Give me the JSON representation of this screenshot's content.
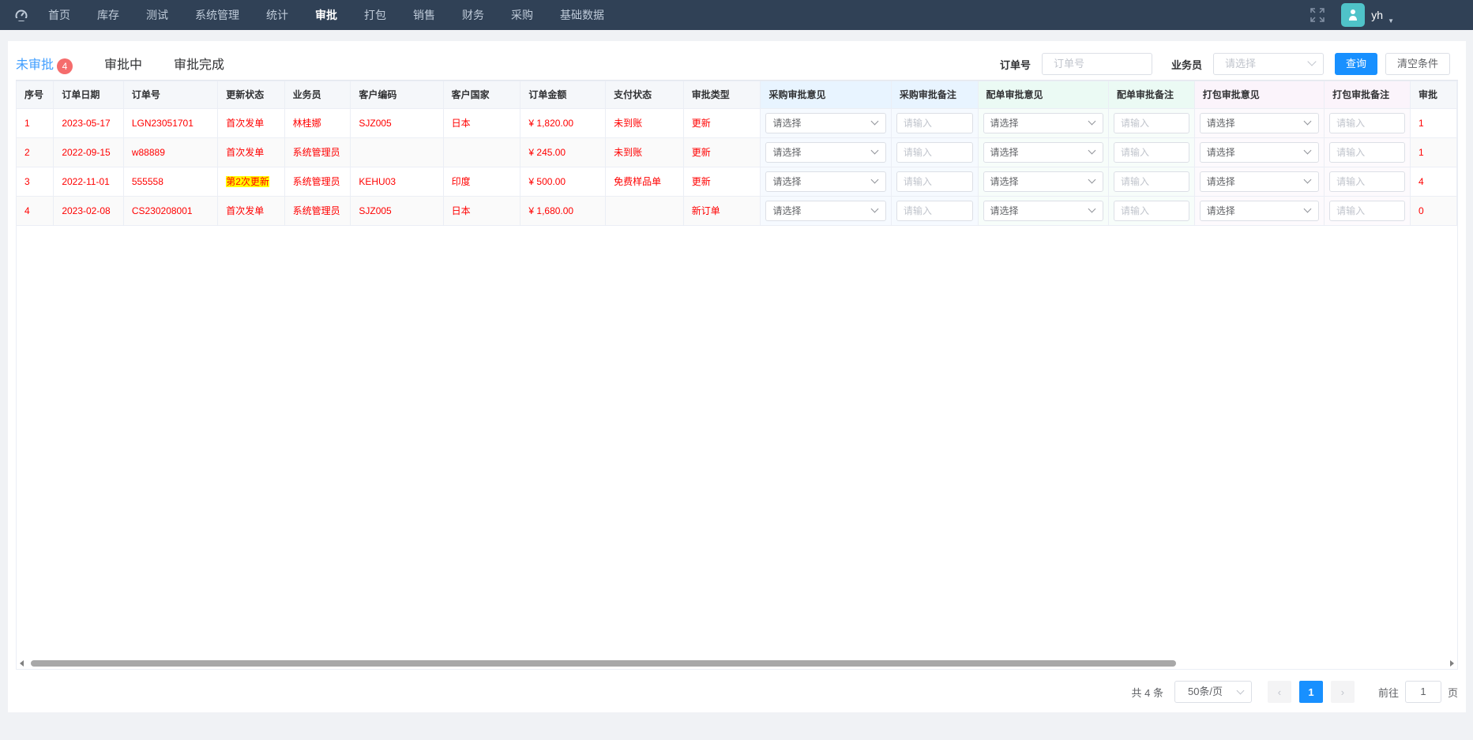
{
  "nav": {
    "items": [
      "首页",
      "库存",
      "测试",
      "系统管理",
      "统计",
      "审批",
      "打包",
      "销售",
      "财务",
      "采购",
      "基础数据"
    ],
    "active_index": 5,
    "username": "yh"
  },
  "tabs": [
    {
      "label": "未审批",
      "badge": "4",
      "active": true
    },
    {
      "label": "审批中",
      "badge": null,
      "active": false
    },
    {
      "label": "审批完成",
      "badge": null,
      "active": false
    }
  ],
  "filters": {
    "order_label": "订单号",
    "order_placeholder": "订单号",
    "salesman_label": "业务员",
    "salesman_placeholder": "请选择",
    "query_button": "查询",
    "clear_button": "清空条件"
  },
  "table": {
    "headers": [
      "序号",
      "订单日期",
      "订单号",
      "更新状态",
      "业务员",
      "客户编码",
      "客户国家",
      "订单金额",
      "支付状态",
      "审批类型",
      "采购审批意见",
      "采购审批备注",
      "配单审批意见",
      "配单审批备注",
      "打包审批意见",
      "打包审批备注",
      "审批"
    ],
    "select_placeholder": "请选择",
    "input_placeholder": "请输入",
    "rows": [
      {
        "idx": "1",
        "date": "2023-05-17",
        "order_no": "LGN23051701",
        "update_status": "首次发单",
        "highlight": false,
        "salesman": "林桂娜",
        "customer_code": "SJZ005",
        "country": "日本",
        "amount": "¥ 1,820.00",
        "pay_status": "未到账",
        "approve_type": "更新",
        "last": "1"
      },
      {
        "idx": "2",
        "date": "2022-09-15",
        "order_no": "w88889",
        "update_status": "首次发单",
        "highlight": false,
        "salesman": "系统管理员",
        "customer_code": "",
        "country": "",
        "amount": "¥ 245.00",
        "pay_status": "未到账",
        "approve_type": "更新",
        "last": "1"
      },
      {
        "idx": "3",
        "date": "2022-11-01",
        "order_no": "555558",
        "update_status": "第2次更新",
        "highlight": true,
        "salesman": "系统管理员",
        "customer_code": "KEHU03",
        "country": "印度",
        "amount": "¥ 500.00",
        "pay_status": "免费样品单",
        "approve_type": "更新",
        "last": "4"
      },
      {
        "idx": "4",
        "date": "2023-02-08",
        "order_no": "CS230208001",
        "update_status": "首次发单",
        "highlight": false,
        "salesman": "系统管理员",
        "customer_code": "SJZ005",
        "country": "日本",
        "amount": "¥ 1,680.00",
        "pay_status": "",
        "approve_type": "新订单",
        "last": "0"
      }
    ]
  },
  "pagination": {
    "total": "共 4 条",
    "page_size": "50条/页",
    "current_page": "1",
    "goto_label": "前往",
    "goto_value": "1",
    "page_suffix": "页"
  },
  "icons": {
    "logo": "dashboard-icon",
    "fullscreen": "fullscreen-icon",
    "avatar": "user-avatar-icon"
  },
  "colors": {
    "nav_bg": "#304156",
    "primary": "#1890ff",
    "row_text": "#ff0000",
    "highlight": "#ffff00",
    "badge": "#f56c6c"
  }
}
